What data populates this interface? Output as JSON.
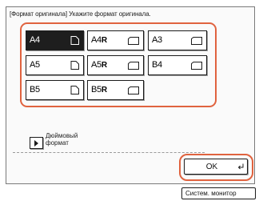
{
  "header": {
    "message": "[Формат оригинала] Укажите формат оригинала."
  },
  "sizes": [
    {
      "label": "A4",
      "rotated": false,
      "orientation": "portrait",
      "selected": true
    },
    {
      "label": "A4",
      "rotated": true,
      "orientation": "landscape",
      "selected": false
    },
    {
      "label": "A3",
      "rotated": false,
      "orientation": "landscape",
      "selected": false
    },
    {
      "label": "A5",
      "rotated": false,
      "orientation": "portrait",
      "selected": false
    },
    {
      "label": "A5",
      "rotated": true,
      "orientation": "landscape",
      "selected": false
    },
    {
      "label": "B4",
      "rotated": false,
      "orientation": "landscape",
      "selected": false
    },
    {
      "label": "B5",
      "rotated": false,
      "orientation": "portrait",
      "selected": false
    },
    {
      "label": "B5",
      "rotated": true,
      "orientation": "landscape",
      "selected": false
    }
  ],
  "rotated_mark": "R",
  "inch_option": {
    "label_line1": "Дюймовый",
    "label_line2": "формат"
  },
  "ok_button": {
    "label": "OK",
    "icon": "enter-icon"
  },
  "monitor_button": {
    "label": "Систем. монитор"
  },
  "colors": {
    "highlight": "#e0633f",
    "selected_fill": "#1e1e1e"
  }
}
